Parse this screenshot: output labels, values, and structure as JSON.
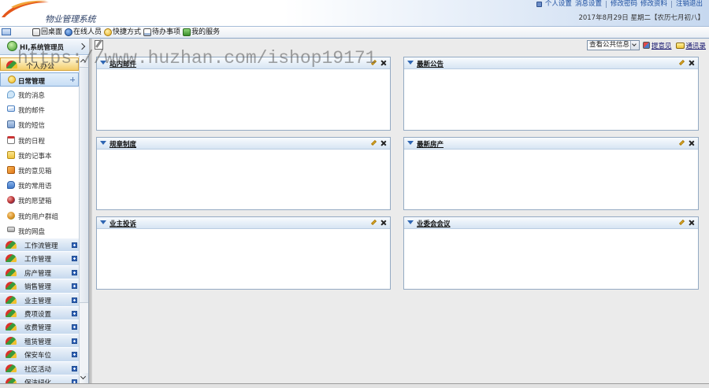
{
  "app": {
    "title": "物业管理系统"
  },
  "header": {
    "link_groups": [
      [
        "个人设置",
        "消息设置"
      ],
      [
        "修改密码",
        "修改资料"
      ],
      [
        "注销退出"
      ]
    ],
    "date": "2017年8月29日 星期二【农历七月初八】"
  },
  "toolbar": {
    "items": [
      {
        "label": "回桌面",
        "icon": "home-icon"
      },
      {
        "label": "在线人员",
        "icon": "online-users-icon"
      },
      {
        "label": "快捷方式",
        "icon": "shortcut-icon"
      },
      {
        "label": "待办事项",
        "icon": "todo-icon"
      },
      {
        "label": "我的服务",
        "icon": "service-icon"
      }
    ]
  },
  "user": {
    "greeting": "HI,系统管理员",
    "icon": "user-status-icon"
  },
  "sidebar": {
    "section": {
      "label": "个人办公",
      "icon": "fan-icon"
    },
    "submenu": {
      "label": "日常管理",
      "icon": "smiley-icon"
    },
    "items": [
      {
        "label": "我的消息",
        "icon": "chat-bubble-icon"
      },
      {
        "label": "我的邮件",
        "icon": "envelope-icon"
      },
      {
        "label": "我的短信",
        "icon": "sms-icon"
      },
      {
        "label": "我的日程",
        "icon": "calendar-icon"
      },
      {
        "label": "我的记事本",
        "icon": "notebook-icon"
      },
      {
        "label": "我的意见箱",
        "icon": "feedback-icon"
      },
      {
        "label": "我的常用语",
        "icon": "phrase-icon"
      },
      {
        "label": "我的愿望箱",
        "icon": "wish-icon"
      },
      {
        "label": "我的用户群组",
        "icon": "user-group-icon"
      },
      {
        "label": "我的网盘",
        "icon": "disk-icon"
      }
    ],
    "group_icon": "fan-icon",
    "groups": [
      {
        "label": "工作流管理"
      },
      {
        "label": "工作管理"
      },
      {
        "label": "房产管理"
      },
      {
        "label": "销售管理"
      },
      {
        "label": "业主管理"
      },
      {
        "label": "费项设置"
      },
      {
        "label": "收费管理"
      },
      {
        "label": "租赁管理"
      },
      {
        "label": "保安车位"
      },
      {
        "label": "社区活动"
      },
      {
        "label": "保洁绿化"
      }
    ]
  },
  "main": {
    "filter_select": {
      "value": "查看公共信息"
    },
    "links": [
      {
        "label": "提意见",
        "icon": "suggestion-icon"
      },
      {
        "label": "通讯录",
        "icon": "contacts-icon"
      }
    ],
    "panels": [
      {
        "title": "站内邮件"
      },
      {
        "title": "最新公告"
      },
      {
        "title": "规章制度"
      },
      {
        "title": "最新房产"
      },
      {
        "title": "业主投诉"
      },
      {
        "title": "业委会会议"
      }
    ]
  },
  "watermark": "https://www.huzhan.com/ishop19171",
  "colors": {
    "link": "#1d4fa0",
    "panel_border": "#94aac3",
    "section_highlight": "#f3cd6a",
    "submenu_highlight": "#c8def5",
    "workspace": "#ebebeb"
  }
}
